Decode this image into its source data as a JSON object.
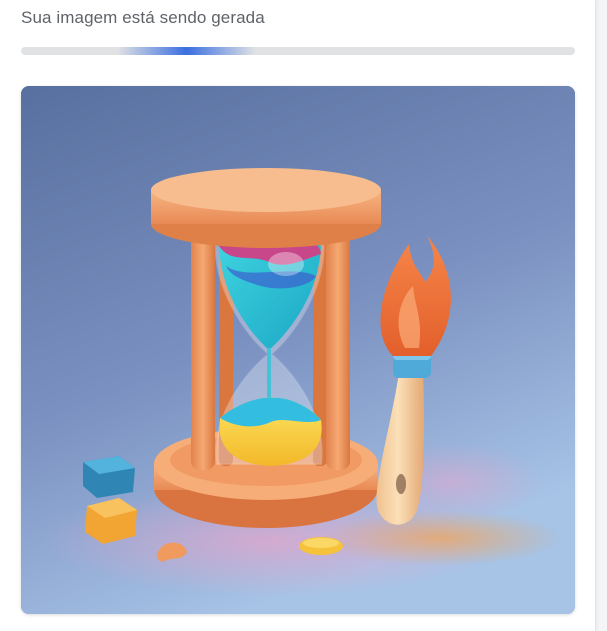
{
  "status": {
    "message": "Sua imagem está sendo gerada",
    "progress": 0.3
  },
  "image": {
    "subject": "hourglass-and-paintbrush-illustration",
    "colors": {
      "background_top": "#58709f",
      "background_bottom": "#a7c3e6",
      "frame": "#f2a06c",
      "sand_top": "#2ec7d6",
      "sand_bottom": "#f7d33a",
      "brush_handle": "#f6d3a4",
      "brush_ferrule": "#4fa9d9",
      "brush_tip": "#f07a3a"
    }
  }
}
